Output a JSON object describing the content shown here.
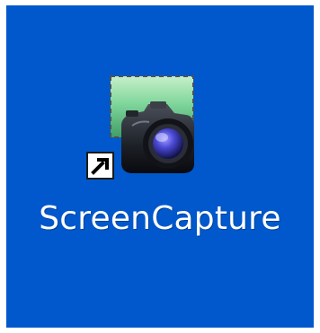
{
  "desktop": {
    "background_color": "#0058cc",
    "icon": {
      "label": "ScreenCapture",
      "icon_name": "camera-screenshot-icon",
      "overlay_name": "shortcut-arrow-icon"
    }
  }
}
